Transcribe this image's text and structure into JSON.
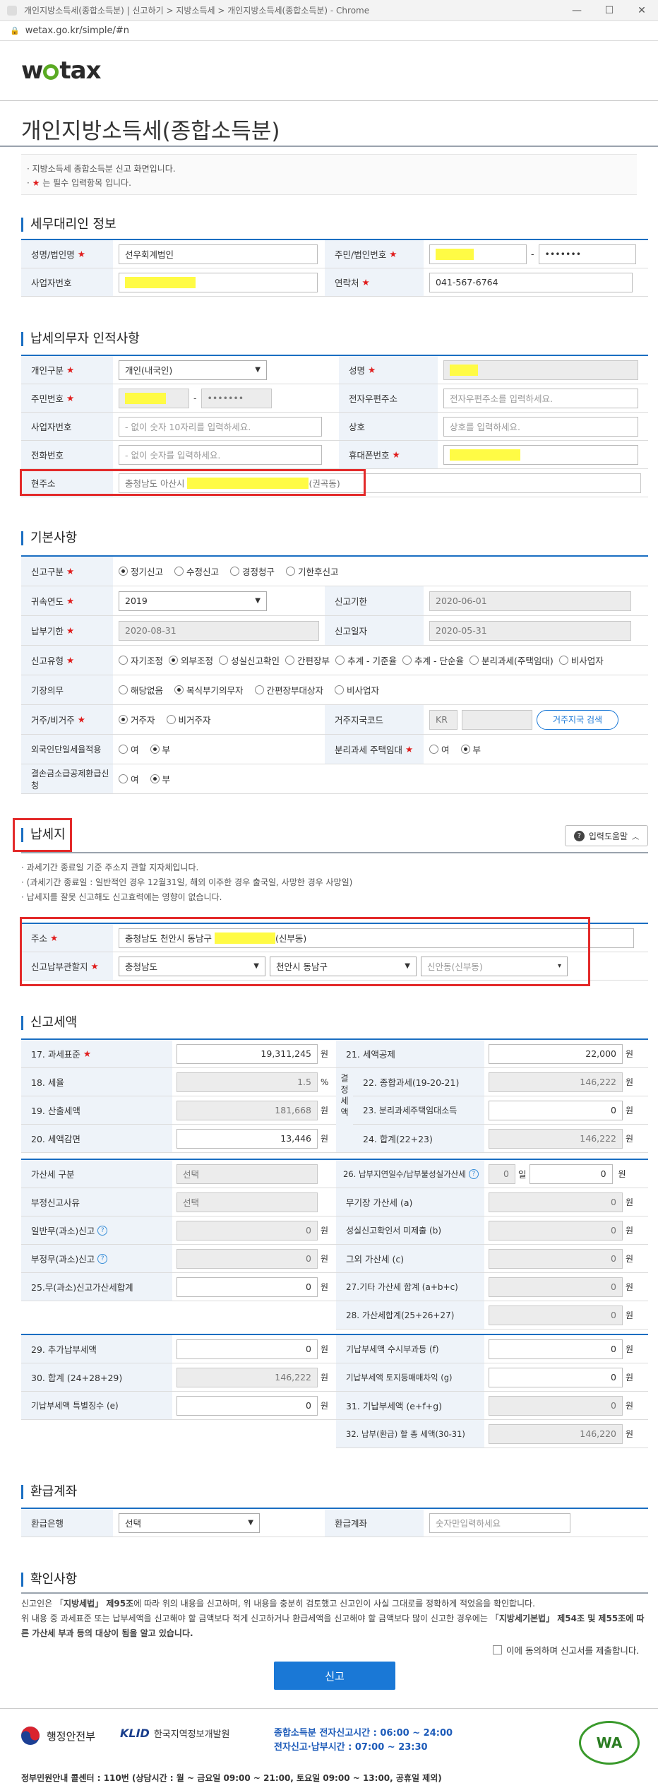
{
  "browser": {
    "title": "개인지방소득세(종합소득분) | 신고하기 > 지방소득세 > 개인지방소득세(종합소득분) - Chrome",
    "url": "wetax.go.kr/simple/#n"
  },
  "logo": {
    "prefix": "w",
    "suffix": "tax"
  },
  "page": {
    "title": "개인지방소득세(종합소득분)",
    "notice1": "· 지방소득세 종합소득분 신고 화면입니다.",
    "notice2_pre": "· ",
    "notice2_star": "★",
    "notice2_post": " 는 필수 입력항목 입니다."
  },
  "agent": {
    "section": "세무대리인 정보",
    "name_label": "성명/법인명",
    "name_value": "선우회계법인",
    "rrn_label": "주민/법인번호",
    "rrn_back": "•••••••",
    "biz_label": "사업자번호",
    "phone_label": "연락처",
    "phone_value": "041-567-6764"
  },
  "taxpayer": {
    "section": "납세의무자 인적사항",
    "type_label": "개인구분",
    "type_value": "개인(내국인)",
    "name_label": "성명",
    "rrn_label": "주민번호",
    "rrn_back": "•••••••",
    "email_label": "전자우편주소",
    "email_ph": "전자우편주소를 입력하세요.",
    "biz_label": "사업자번호",
    "biz_ph": "- 없이 숫자 10자리를 입력하세요.",
    "trade_label": "상호",
    "trade_ph": "상호를 입력하세요.",
    "tel_label": "전화번호",
    "tel_ph": "- 없이 숫자를 입력하세요.",
    "mobile_label": "휴대폰번호",
    "addr_label": "현주소",
    "addr_prefix": "충청남도 아산시",
    "addr_suffix": "(권곡동)"
  },
  "basic": {
    "section": "기본사항",
    "report_type_label": "신고구분",
    "report_types": [
      "정기신고",
      "수정신고",
      "경정청구",
      "기한후신고"
    ],
    "year_label": "귀속연도",
    "year_value": "2019",
    "deadline_label": "신고기한",
    "deadline_value": "2020-06-01",
    "pay_deadline_label": "납부기한",
    "pay_deadline_value": "2020-08-31",
    "report_date_label": "신고일자",
    "report_date_value": "2020-05-31",
    "kind_label": "신고유형",
    "kinds": [
      "자기조정",
      "외부조정",
      "성실신고확인",
      "간편장부",
      "추계 - 기준율",
      "추계 - 단순율",
      "분리과세(주택임대)",
      "비사업자"
    ],
    "book_label": "기장의무",
    "books": [
      "해당없음",
      "복식부기의무자",
      "간편장부대상자",
      "비사업자"
    ],
    "res_label": "거주/비거주",
    "res": [
      "거주자",
      "비거주자"
    ],
    "country_label": "거주지국코드",
    "country_value": "KR",
    "country_btn": "거주지국 검색",
    "foreign_label": "외국인단일세율적용",
    "foreign": [
      "여",
      "부"
    ],
    "rent_label": "분리과세 주택임대",
    "rent": [
      "여",
      "부"
    ],
    "deduct_label": "결손금소급공제환급신청",
    "deduct": [
      "여",
      "부"
    ]
  },
  "taxplace": {
    "section": "납세지",
    "help": "입력도움말",
    "b1": "· 과세기간 종료일 기준 주소지 관할 지자체입니다.",
    "b2": "· (과세기간 종료일 : 일반적인 경우 12월31일, 해외 이주한 경우 출국일, 사망한 경우 사망일)",
    "b3": "· 납세지를 잘못 신고해도 신고효력에는 영향이 없습니다.",
    "addr_label": "주소",
    "addr_prefix": "충청남도 천안시 동남구",
    "addr_suffix": "(신부동)",
    "office_label": "신고납부관할지",
    "sido": "충청남도",
    "sigungu": "천안시 동남구",
    "dong": "신안동(신부동)"
  },
  "amount": {
    "section": "신고세액",
    "unit": "원",
    "pct": "%",
    "l17": "17. 과세표준",
    "v17": "19,311,245",
    "l18": "18. 세율",
    "v18": "1.5",
    "l19": "19. 산출세액",
    "v19": "181,668",
    "l20": "20. 세액감면",
    "v20": "13,446",
    "side": "결정세액",
    "l21": "21. 세액공제",
    "v21": "22,000",
    "l22": "22. 종합과세(19-20-21)",
    "v22": "146,222",
    "l23": "23. 분리과세주택임대소득",
    "v23": "0",
    "l24": "24. 합계(22+23)",
    "v24": "146,222",
    "penalty_label": "가산세 구분",
    "penalty_ph": "선택",
    "reason_label": "부정신고사유",
    "reason_ph": "선택",
    "l26": "26. 납부지연일수/납부불성실가산세",
    "v26a": "0",
    "day": "일",
    "v26b": "0",
    "lnr": "일반무(과소)신고",
    "vnr": "0",
    "lnb": "무기장 가산세 (a)",
    "vnb": "0",
    "lfr": "부정무(과소)신고",
    "vfr": "0",
    "lcr": "성실신고확인서 미제출 (b)",
    "vcr": "0",
    "l25": "25.무(과소)신고가산세합계",
    "v25": "0",
    "lother": "그외 가산세 (c)",
    "vother": "0",
    "l27": "27.기타 가산세 합계 (a+b+c)",
    "v27": "0",
    "l28": "28. 가산세합계(25+26+27)",
    "v28": "0",
    "l29": "29. 추가납부세액",
    "v29": "0",
    "lf": "기납부세액 수시부과등 (f)",
    "vf": "0",
    "l30": "30. 합계 (24+28+29)",
    "v30": "146,222",
    "lg": "기납부세액 토지등매매차익 (g)",
    "vg": "0",
    "le": "기납부세액 특별징수 (e)",
    "ve": "0",
    "l31": "31. 기납부세액 (e+f+g)",
    "v31": "0",
    "l32": "32. 납부(환급) 할 총 세액(30-31)",
    "v32": "146,220"
  },
  "refund": {
    "section": "환급계좌",
    "bank_label": "환급은행",
    "bank_value": "선택",
    "acct_label": "환급계좌",
    "acct_ph": "숫자만입력하세요"
  },
  "confirm": {
    "section": "확인사항",
    "t1a": "신고인은 「",
    "t1b": "지방세법」 제95조",
    "t1c": "에 따라 위의 내용을 신고하며, 위 내용을 충분히 검토했고 신고인이 사실 그대로를 정확하게 적었음을 확인합니다.",
    "t2a": "위 내용 중 과세표준 또는 납부세액을 신고해야 할 금액보다 적게 신고하거나 환급세액을 신고해야 할 금액보다 많이 신고한 경우에는 「",
    "t2b": "지방세기본법」 제54조 및 제55조에 따른 가산세 부과 등의 대상이 됨을 알고 있습니다.",
    "agree": "이에 동의하며 신고서를 제출합니다.",
    "submit": "신고"
  },
  "footer": {
    "ministry": "행정안전부",
    "klid_en": "KLID",
    "klid_kr": "한국지역정보개발원",
    "hours1": "종합소득분 전자신고시간 : 06:00 ~ 24:00",
    "hours2": "전자신고·납부시간 : 07:00 ~ 23:30",
    "call": "정부민원안내 콜센터 : 110번 (상담시간 : 월 ~ 금요일 09:00 ~ 21:00, 토요일 09:00 ~ 13:00, 공휴일 제외)",
    "wa_badge": "WA"
  }
}
